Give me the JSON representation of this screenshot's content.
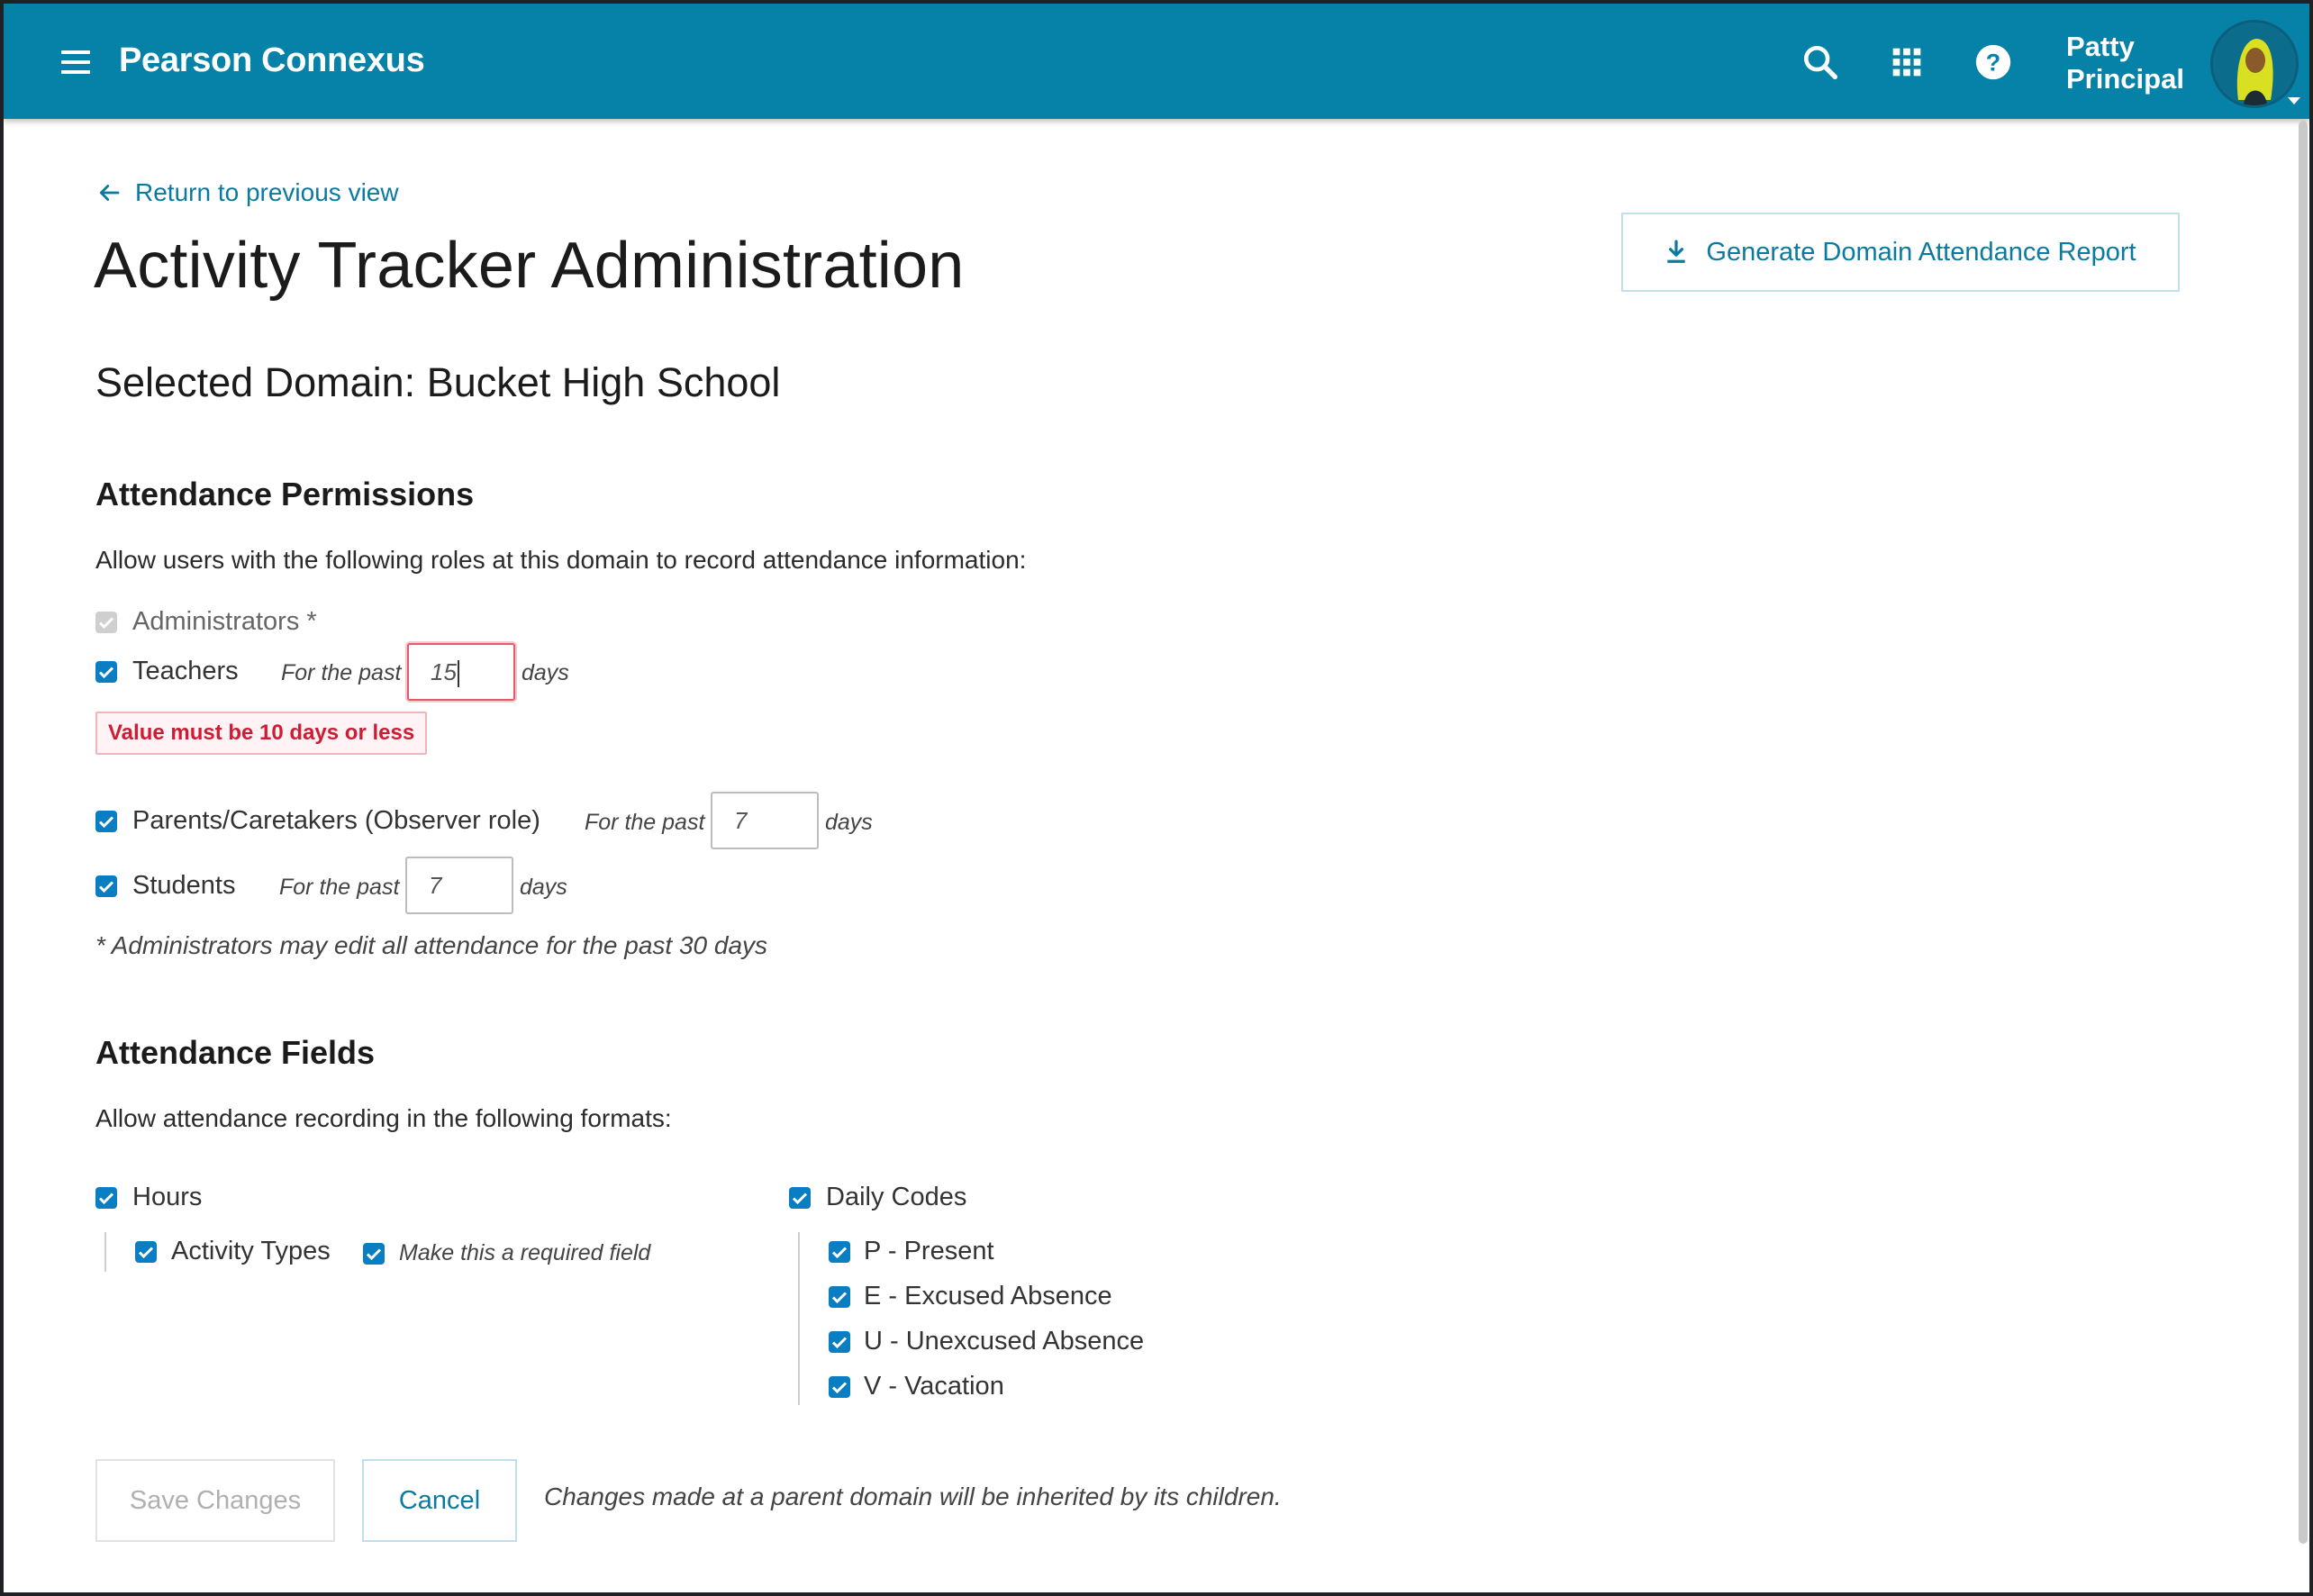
{
  "header": {
    "brand": "Pearson Connexus",
    "menu_icon": "hamburger-menu-icon",
    "search_icon": "search-icon",
    "apps_icon": "apps-grid-icon",
    "help_icon": "help-icon",
    "user_first": "Patty",
    "user_last": "Principal",
    "accent": "#0681a7"
  },
  "page": {
    "back_link": "Return to previous view",
    "title": "Activity Tracker Administration",
    "report_button": "Generate Domain Attendance Report",
    "domain_label": "Selected Domain: Bucket High School"
  },
  "permissions": {
    "heading": "Attendance Permissions",
    "description": "Allow users with the following roles at this domain to record attendance information:",
    "roles": [
      {
        "label": "Administrators *",
        "checked": true,
        "disabled": true
      },
      {
        "label": "Teachers",
        "checked": true,
        "prefix": "For the past",
        "value": "15",
        "suffix": "days"
      },
      {
        "label": "Parents/Caretakers (Observer role)",
        "checked": true,
        "prefix": "For the past",
        "value": "7",
        "suffix": "days"
      },
      {
        "label": "Students",
        "checked": true,
        "prefix": "For the past",
        "value": "7",
        "suffix": "days"
      }
    ],
    "error": "Value must be 10 days or less",
    "note": "* Administrators may edit all attendance for the past 30 days"
  },
  "fields": {
    "heading": "Attendance Fields",
    "description": "Allow attendance recording in the following formats:",
    "hours": {
      "label": "Hours",
      "checked": true,
      "activity_types": "Activity Types",
      "required_label": "Make this a required field"
    },
    "daily_codes": {
      "label": "Daily Codes",
      "checked": true,
      "codes": [
        "P - Present",
        "E - Excused Absence",
        "U - Unexcused Absence",
        "V - Vacation"
      ]
    }
  },
  "footer": {
    "save": "Save Changes",
    "cancel": "Cancel",
    "note": "Changes made at a parent domain will be inherited by its children."
  }
}
